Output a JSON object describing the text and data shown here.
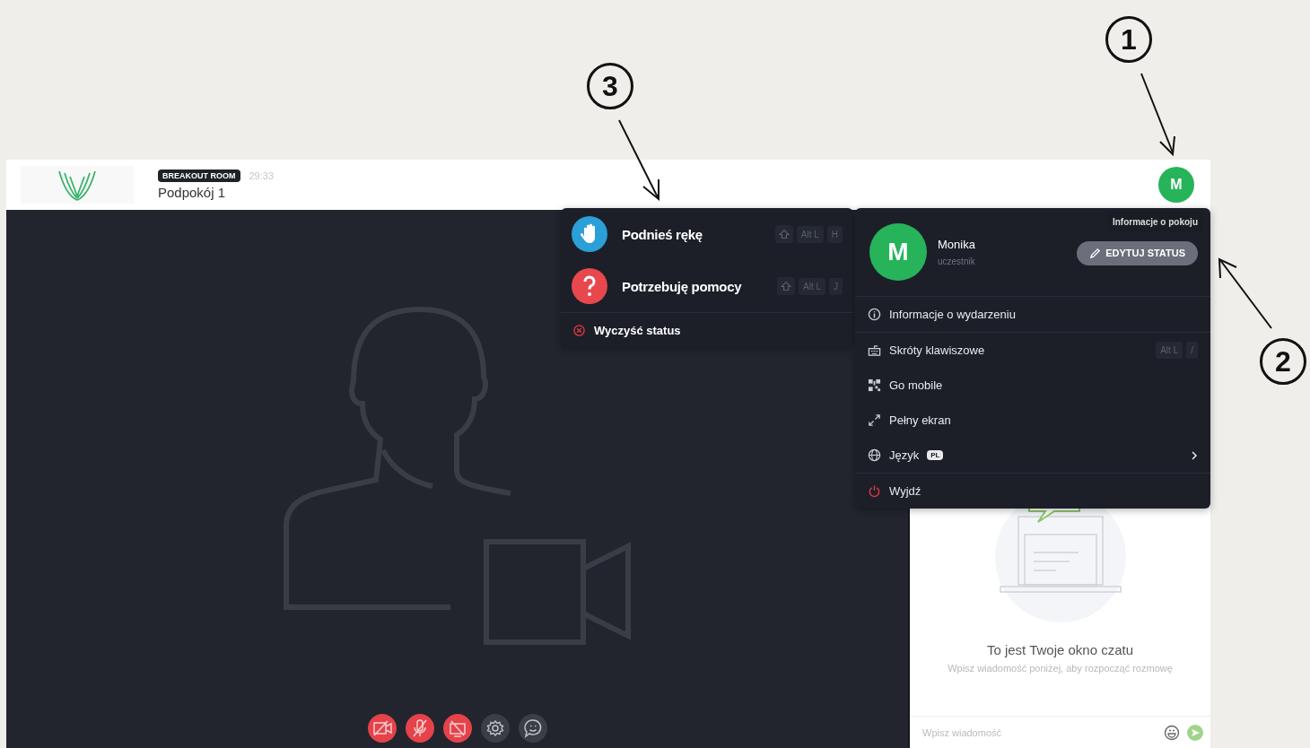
{
  "annotations": [
    {
      "label": "1"
    },
    {
      "label": "3"
    },
    {
      "label": "2"
    }
  ],
  "header": {
    "badge": "BREAKOUT ROOM",
    "timer": "29:33",
    "room": "Podpokój 1",
    "avatar": "M"
  },
  "status_menu": {
    "items": [
      {
        "kind": "hand",
        "label": "Podnieś rękę",
        "keys": [
          "Alt L",
          "H"
        ]
      },
      {
        "kind": "help",
        "label": "Potrzebuję pomocy",
        "keys": [
          "Alt L",
          "J"
        ]
      }
    ],
    "clear": "Wyczyść status"
  },
  "user_menu": {
    "tooltip": "Informacje o pokoju",
    "avatar": "M",
    "name": "Monika",
    "role": "uczestnik",
    "edit_button": "EDYTUJ STATUS",
    "groups": [
      [
        {
          "kind": "info",
          "label": "Informacje o wydarzeniu"
        }
      ],
      [
        {
          "kind": "keyboard",
          "label": "Skróty klawiszowe",
          "keys": [
            "Alt L",
            "/"
          ]
        },
        {
          "kind": "qr",
          "label": "Go mobile"
        },
        {
          "kind": "expand",
          "label": "Pełny ekran"
        },
        {
          "kind": "globe",
          "label": "Język",
          "badge": "PL",
          "submenu": true
        }
      ],
      [
        {
          "kind": "power",
          "label": "Wyjdź"
        }
      ]
    ]
  },
  "toolbar": [
    {
      "kind": "camera",
      "muted": true
    },
    {
      "kind": "mic",
      "muted": true
    },
    {
      "kind": "screen",
      "muted": true
    },
    {
      "kind": "settings",
      "muted": false
    },
    {
      "kind": "chat",
      "muted": false
    }
  ],
  "chat": {
    "title": "To jest Twoje okno czatu",
    "subtitle": "Wpisz wiadomość poniżej, aby rozpocząć rozmowę",
    "input": {
      "placeholder": "Wpisz wiadomość"
    }
  }
}
